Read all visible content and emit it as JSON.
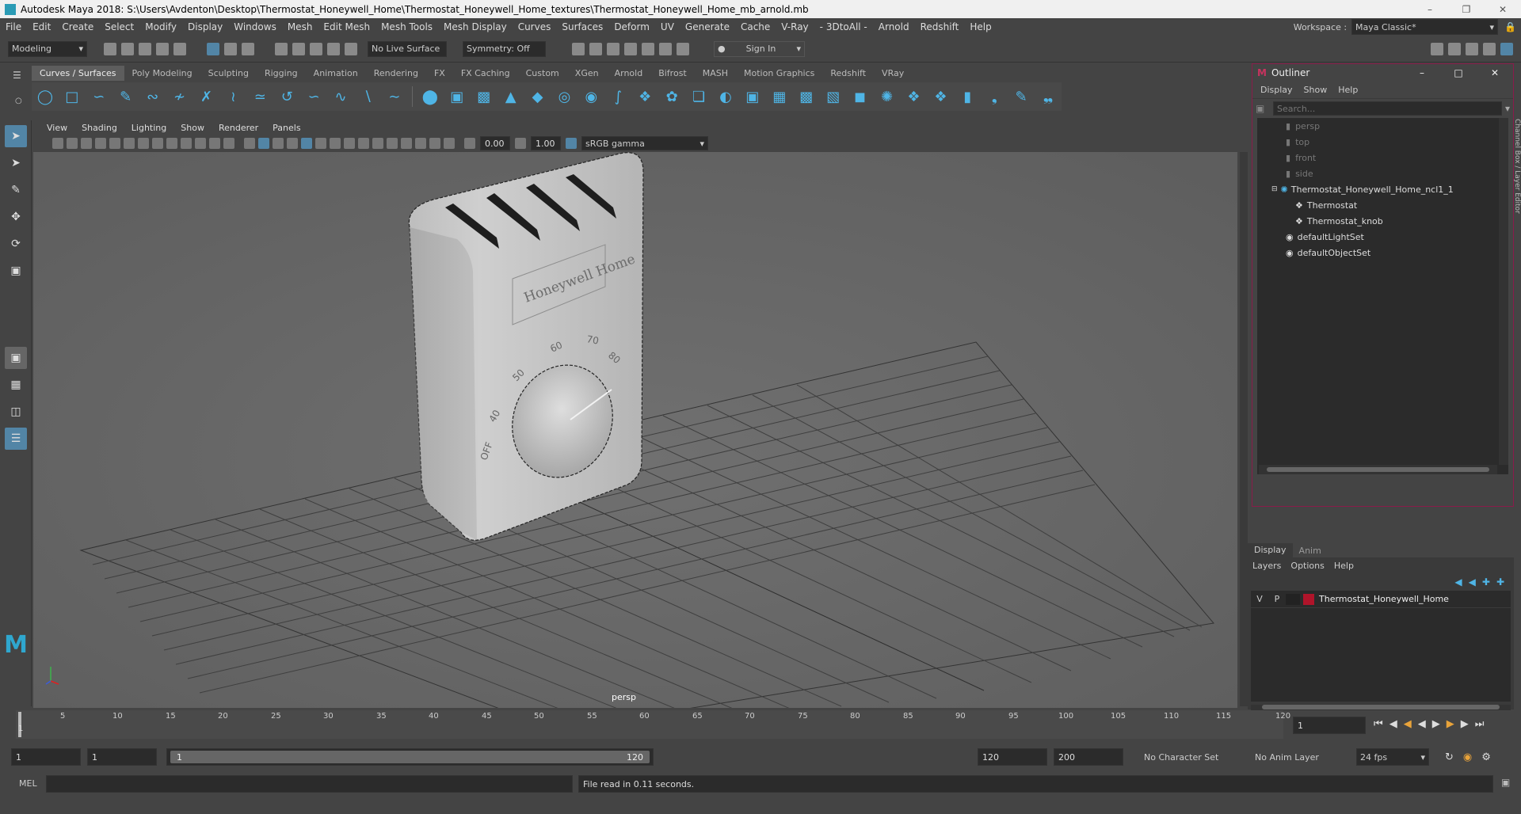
{
  "title": "Autodesk Maya 2018: S:\\Users\\Avdenton\\Desktop\\Thermostat_Honeywell_Home\\Thermostat_Honeywell_Home_textures\\Thermostat_Honeywell_Home_mb_arnold.mb",
  "menu": [
    "File",
    "Edit",
    "Create",
    "Select",
    "Modify",
    "Display",
    "Windows",
    "Mesh",
    "Edit Mesh",
    "Mesh Tools",
    "Mesh Display",
    "Curves",
    "Surfaces",
    "Deform",
    "UV",
    "Generate",
    "Cache",
    "V-Ray",
    "- 3DtoAll -",
    "Arnold",
    "Redshift",
    "Help"
  ],
  "workspace": {
    "label": "Workspace :",
    "value": "Maya Classic*"
  },
  "status": {
    "mode": "Modeling",
    "live_surface": "No Live Surface",
    "symmetry": "Symmetry: Off",
    "sign_in": "Sign In"
  },
  "shelf_tabs": [
    "Curves / Surfaces",
    "Poly Modeling",
    "Sculpting",
    "Rigging",
    "Animation",
    "Rendering",
    "FX",
    "FX Caching",
    "Custom",
    "XGen",
    "Arnold",
    "Bifrost",
    "MASH",
    "Motion Graphics",
    "Redshift",
    "VRay"
  ],
  "panel_menu": [
    "View",
    "Shading",
    "Lighting",
    "Show",
    "Renderer",
    "Panels"
  ],
  "panel_values": {
    "exposure": "0.00",
    "gamma": "1.00",
    "color_space": "sRGB gamma"
  },
  "viewport": {
    "camera": "persp",
    "brand": "Honeywell Home",
    "dial_marks": [
      "OFF",
      "40",
      "50",
      "60",
      "70",
      "80"
    ]
  },
  "outliner": {
    "title": "Outliner",
    "menu": [
      "Display",
      "Show",
      "Help"
    ],
    "search_placeholder": "Search...",
    "items": [
      {
        "label": "persp",
        "dim": true
      },
      {
        "label": "top",
        "dim": true
      },
      {
        "label": "front",
        "dim": true
      },
      {
        "label": "side",
        "dim": true
      },
      {
        "label": "Thermostat_Honeywell_Home_ncl1_1",
        "dim": false
      },
      {
        "label": "Thermostat",
        "dim": false
      },
      {
        "label": "Thermostat_knob",
        "dim": false
      },
      {
        "label": "defaultLightSet",
        "dim": false
      },
      {
        "label": "defaultObjectSet",
        "dim": false
      }
    ],
    "side_tab": "Channel Box / Layer Editor"
  },
  "layer_editor": {
    "tabs": [
      "Display",
      "Anim"
    ],
    "menu": [
      "Layers",
      "Options",
      "Help"
    ],
    "layer": {
      "v": "V",
      "p": "P",
      "name": "Thermostat_Honeywell_Home",
      "color": "#b0142a"
    }
  },
  "timeline": {
    "ticks": [
      "1",
      "5",
      "10",
      "15",
      "20",
      "25",
      "30",
      "35",
      "40",
      "45",
      "50",
      "55",
      "60",
      "65",
      "70",
      "75",
      "80",
      "85",
      "90",
      "95",
      "100",
      "105",
      "110",
      "115",
      "120"
    ],
    "current_frame": "1"
  },
  "range": {
    "start": "1",
    "playback_start": "1",
    "slider_start": "1",
    "slider_end": "120",
    "playback_end": "120",
    "end": "200",
    "character_set": "No Character Set",
    "anim_layer": "No Anim Layer",
    "fps": "24 fps"
  },
  "cmdline": {
    "label": "MEL",
    "message": "File read in  0.11 seconds."
  }
}
